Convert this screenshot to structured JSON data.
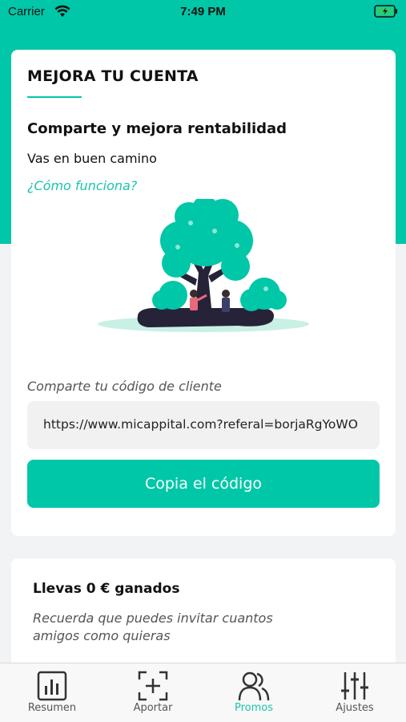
{
  "status_bar": {
    "carrier": "Carrier",
    "time": "7:49 PM"
  },
  "main_card": {
    "title": "MEJORA TU CUENTA",
    "subtitle": "Comparte y mejora rentabilidad",
    "progress_text": "Vas en buen camino",
    "how_link": "¿Cómo funciona?",
    "share_label": "Comparte tu código de cliente",
    "referral_code": "https://www.micappital.com?referal=borjaRgYoWO",
    "copy_button": "Copia el código"
  },
  "earnings_card": {
    "title": "Llevas 0 € ganados",
    "description": "Recuerda que puedes invitar cuantos amigos como quieras"
  },
  "tab_bar": {
    "items": [
      {
        "label": "Resumen",
        "icon": "chart-icon"
      },
      {
        "label": "Aportar",
        "icon": "add-icon"
      },
      {
        "label": "Promos",
        "icon": "people-icon"
      },
      {
        "label": "Ajustes",
        "icon": "sliders-icon"
      }
    ],
    "active": "Promos"
  },
  "colors": {
    "accent": "#00c7a8",
    "link": "#1cc4ad",
    "background": "#f2f3f5"
  }
}
